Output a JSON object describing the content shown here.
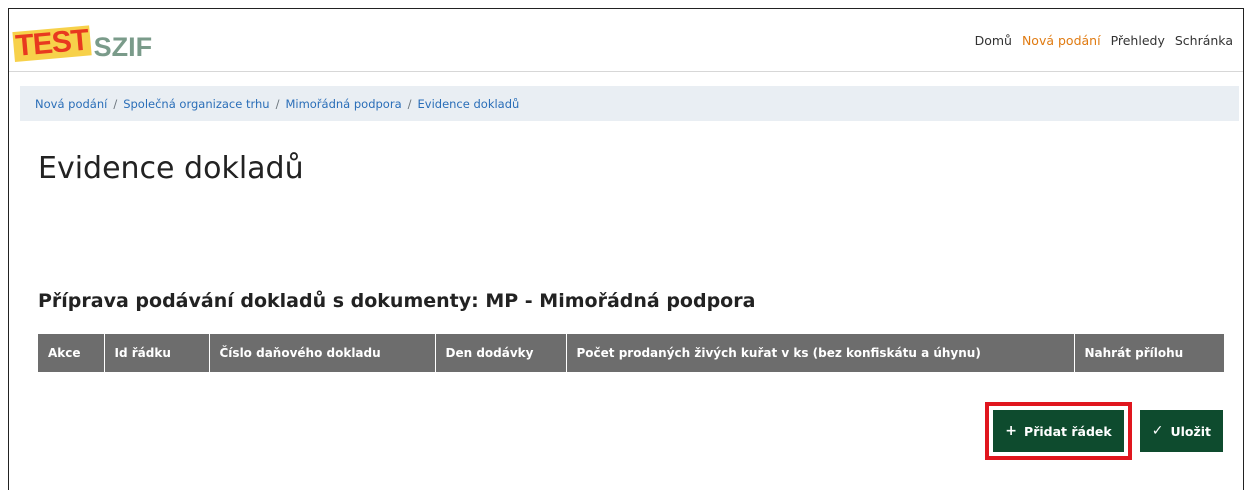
{
  "logo": {
    "test": "TEST",
    "brand": "SZIF"
  },
  "nav": {
    "items": [
      {
        "label": "Domů",
        "active": false
      },
      {
        "label": "Nová podání",
        "active": true
      },
      {
        "label": "Přehledy",
        "active": false
      },
      {
        "label": "Schránka",
        "active": false
      }
    ]
  },
  "breadcrumb": [
    "Nová podání",
    "Společná organizace trhu",
    "Mimořádná podpora",
    "Evidence dokladů"
  ],
  "page": {
    "title": "Evidence dokladů",
    "section_title": "Příprava podávání dokladů s dokumenty: MP - Mimořádná podpora"
  },
  "table": {
    "columns": [
      "Akce",
      "Id řádku",
      "Číslo daňového dokladu",
      "Den dodávky",
      "Počet prodaných živých kuřat v ks (bez konfiskátu a úhynu)",
      "Nahrát přílohu"
    ]
  },
  "buttons": {
    "add_row": "Přidat řádek",
    "save": "Uložit"
  },
  "colors": {
    "accent_nav": "#e07b12",
    "button_bg": "#0e4b2e",
    "table_header_bg": "#6d6d6d",
    "highlight_border": "#e0161e"
  },
  "icons": {
    "add": "plus-icon",
    "save": "check-icon"
  }
}
